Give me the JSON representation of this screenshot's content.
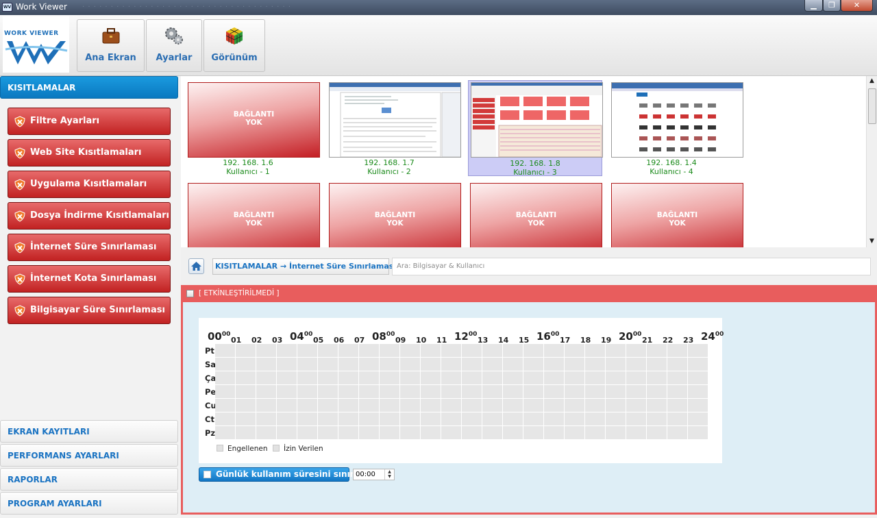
{
  "window": {
    "title": "Work Viewer",
    "icon": "work-viewer-app-icon",
    "min_label": "▁",
    "max_label": "❐",
    "close_label": "✕"
  },
  "logo": {
    "text": "WORK VIEWER",
    "mark": "WV"
  },
  "toolbar": {
    "buttons": [
      {
        "label": "Ana Ekran",
        "icon": "briefcase-icon"
      },
      {
        "label": "Ayarlar",
        "icon": "gears-icon"
      },
      {
        "label": "Görünüm",
        "icon": "rubiks-cube-icon"
      }
    ]
  },
  "sidebar": {
    "active_section": "KISITLAMALAR",
    "items": [
      {
        "label": "Filtre Ayarları"
      },
      {
        "label": "Web Site Kısıtlamaları"
      },
      {
        "label": "Uygulama Kısıtlamaları"
      },
      {
        "label": "Dosya İndirme Kısıtlamaları"
      },
      {
        "label": "İnternet Süre Sınırlaması"
      },
      {
        "label": "İnternet Kota Sınırlaması"
      },
      {
        "label": "Bilgisayar Süre Sınırlaması"
      }
    ],
    "bottom_sections": [
      "EKRAN KAYITLARI",
      "PERFORMANS AYARLARI",
      "RAPORLAR",
      "PROGRAM AYARLARI"
    ]
  },
  "clients": [
    {
      "ip": "192. 168. 1.6",
      "user": "Kullanıcı - 1",
      "status_line1": "BAĞLANTI",
      "status_line2": "YOK",
      "connected": false
    },
    {
      "ip": "192. 168. 1.7",
      "user": "Kullanıcı - 2",
      "connected": true
    },
    {
      "ip": "192. 168. 1.8",
      "user": "Kullanıcı - 3",
      "connected": true,
      "selected": true
    },
    {
      "ip": "192. 168. 1.4",
      "user": "Kullanıcı - 4",
      "connected": true
    },
    {
      "status_line1": "BAĞLANTI",
      "status_line2": "YOK",
      "connected": false
    },
    {
      "status_line1": "BAĞLANTI",
      "status_line2": "YOK",
      "connected": false
    },
    {
      "status_line1": "BAĞLANTI",
      "status_line2": "YOK",
      "connected": false
    },
    {
      "status_line1": "BAĞLANTI",
      "status_line2": "YOK",
      "connected": false
    }
  ],
  "breadcrumb": {
    "root": "KISITLAMALAR",
    "arrow": "→",
    "current": "İnternet Süre Sınırlaması"
  },
  "search": {
    "placeholder": "Ara: Bilgisayar & Kullanıcı"
  },
  "panel": {
    "status": "[ ETKİNLEŞTİRİLMEDİ ]",
    "hours": [
      "00",
      "01",
      "02",
      "03",
      "04",
      "05",
      "06",
      "07",
      "08",
      "09",
      "10",
      "11",
      "12",
      "13",
      "14",
      "15",
      "16",
      "17",
      "18",
      "19",
      "20",
      "21",
      "22",
      "23",
      "24"
    ],
    "hour_suffix": "00",
    "days": [
      "Pt",
      "Sa",
      "Ça",
      "Pe",
      "Cu",
      "Ct",
      "Pz"
    ],
    "legend_blocked": "Engellenen",
    "legend_allowed": "İzin Verilen",
    "daily_limit_label": "Günlük kullanım süresini sınırla:",
    "daily_limit_value": "00:00"
  }
}
